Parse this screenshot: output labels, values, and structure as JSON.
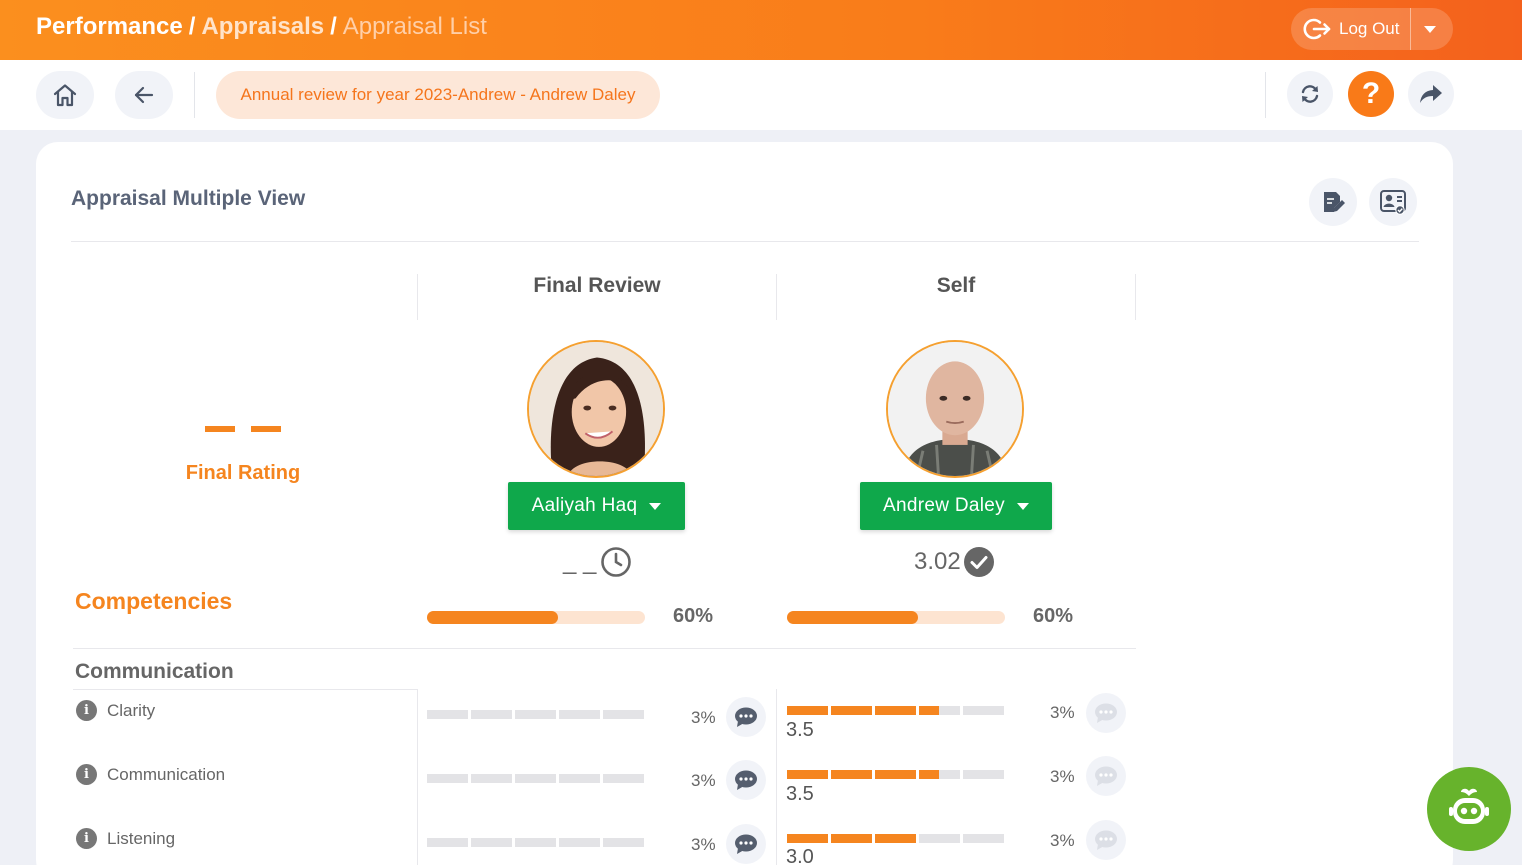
{
  "breadcrumb": {
    "item1": "Performance",
    "item2": "Appraisals",
    "item3": "Appraisal List",
    "separator": "/"
  },
  "header": {
    "logout_label": "Log Out"
  },
  "toolbar": {
    "review_title": "Annual review for year 2023-Andrew - Andrew Daley",
    "help_glyph": "?"
  },
  "card": {
    "title": "Appraisal Multiple View",
    "final_rating_label": "Final Rating",
    "columns": [
      {
        "header": "Final Review",
        "reviewer": "Aaliyah Haq",
        "score": "_ _",
        "status_icon": "clock-icon",
        "progress_pct": "60%",
        "progress_value": 0.6
      },
      {
        "header": "Self",
        "reviewer": "Andrew Daley",
        "score": "3.02",
        "status_icon": "check-circle-icon",
        "progress_pct": "60%",
        "progress_value": 0.6
      }
    ],
    "competencies_label": "Competencies",
    "section": {
      "title": "Communication",
      "rows": [
        {
          "label": "Clarity",
          "final_pct": "3%",
          "self_pct": "3%",
          "self_value": "3.5"
        },
        {
          "label": "Communication",
          "final_pct": "3%",
          "self_pct": "3%",
          "self_value": "3.5"
        },
        {
          "label": "Listening",
          "final_pct": "3%",
          "self_pct": "3%",
          "self_value": "3.0"
        }
      ]
    }
  },
  "colors": {
    "brand_orange": "#f5851f",
    "button_green": "#0fa84b",
    "bot_green": "#67b32c"
  }
}
